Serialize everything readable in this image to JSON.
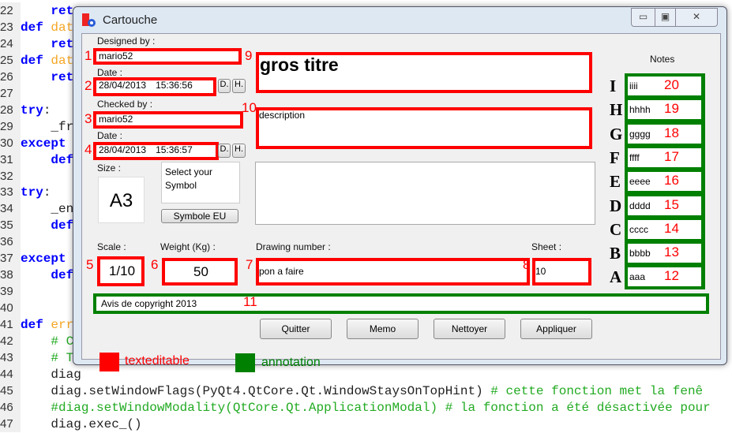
{
  "code_lines": [
    {
      "n": "22",
      "parts": [
        [
          "tx",
          "    "
        ],
        [
          "kw",
          "ret"
        ]
      ]
    },
    {
      "n": "23",
      "parts": [
        [
          "kw",
          "def "
        ],
        [
          "fn",
          "dat"
        ]
      ]
    },
    {
      "n": "24",
      "parts": [
        [
          "tx",
          "    "
        ],
        [
          "kw",
          "ret"
        ]
      ]
    },
    {
      "n": "25",
      "parts": [
        [
          "kw",
          "def "
        ],
        [
          "fn",
          "dat"
        ]
      ]
    },
    {
      "n": "26",
      "parts": [
        [
          "tx",
          "    "
        ],
        [
          "kw",
          "ret"
        ]
      ]
    },
    {
      "n": "27",
      "parts": []
    },
    {
      "n": "28",
      "parts": [
        [
          "kw",
          "try"
        ],
        [
          "tx",
          ":"
        ]
      ]
    },
    {
      "n": "29",
      "parts": [
        [
          "tx",
          "    _fr"
        ]
      ]
    },
    {
      "n": "30",
      "parts": [
        [
          "kw",
          "except"
        ]
      ]
    },
    {
      "n": "31",
      "parts": [
        [
          "tx",
          "    "
        ],
        [
          "kw",
          "def"
        ]
      ]
    },
    {
      "n": "32",
      "parts": []
    },
    {
      "n": "33",
      "parts": [
        [
          "kw",
          "try"
        ],
        [
          "tx",
          ":"
        ]
      ]
    },
    {
      "n": "34",
      "parts": [
        [
          "tx",
          "    _en"
        ]
      ]
    },
    {
      "n": "35",
      "parts": [
        [
          "tx",
          "    "
        ],
        [
          "kw",
          "def"
        ]
      ]
    },
    {
      "n": "36",
      "parts": []
    },
    {
      "n": "37",
      "parts": [
        [
          "kw",
          "except"
        ]
      ]
    },
    {
      "n": "38",
      "parts": [
        [
          "tx",
          "    "
        ],
        [
          "kw",
          "def"
        ]
      ]
    },
    {
      "n": "39",
      "parts": []
    },
    {
      "n": "40",
      "parts": []
    },
    {
      "n": "41",
      "parts": [
        [
          "kw",
          "def "
        ],
        [
          "fn",
          "err"
        ]
      ]
    },
    {
      "n": "42",
      "parts": [
        [
          "cm",
          "    # C"
        ]
      ]
    },
    {
      "n": "43",
      "parts": [
        [
          "cm",
          "    # T"
        ]
      ]
    },
    {
      "n": "44",
      "parts": [
        [
          "tx",
          "    diag"
        ]
      ]
    },
    {
      "n": "45",
      "parts": [
        [
          "tx",
          "    diag.setWindowFlags(PyQt4.QtCore.Qt.WindowStaysOnTopHint) "
        ],
        [
          "cm",
          "# cette fonction met la fenê"
        ]
      ]
    },
    {
      "n": "46",
      "parts": [
        [
          "cm",
          "    #diag.setWindowModality(QtCore.Qt.ApplicationModal) # la fonction a été désactivée pour"
        ]
      ]
    },
    {
      "n": "47",
      "parts": [
        [
          "tx",
          "    diag.exec_()"
        ]
      ]
    }
  ],
  "window": {
    "title": "Cartouche",
    "minimize": "▭",
    "maximize": "▣",
    "close": "✕"
  },
  "form": {
    "designed_by_label": "Designed by :",
    "designed_by": "mario52",
    "date_label": "Date :",
    "date1": "28/04/2013",
    "time1": "15:36:56",
    "checked_by_label": "Checked by :",
    "checked_by": "mario52",
    "date2": "28/04/2013",
    "time2": "15:36:57",
    "d_button": "D.",
    "h_button": "H.",
    "size_label": "Size :",
    "size": "A3",
    "symbol_text": "Select your Symbol",
    "symbol_button": "Symbole EU",
    "title": "gros titre",
    "description": "description",
    "scale_label": "Scale :",
    "scale": "1/10",
    "weight_label": "Weight (Kg) :",
    "weight": "50",
    "drawing_label": "Drawing number :",
    "drawing": "pon a faire",
    "sheet_label": "Sheet :",
    "sheet": "10",
    "copyright": "Avis de copyright 2013",
    "notes_label": "Notes",
    "notes": [
      {
        "letter": "I",
        "value": "iiii",
        "num": "20"
      },
      {
        "letter": "H",
        "value": "hhhh",
        "num": "19"
      },
      {
        "letter": "G",
        "value": "gggg",
        "num": "18"
      },
      {
        "letter": "F",
        "value": "ffff",
        "num": "17"
      },
      {
        "letter": "E",
        "value": "eeee",
        "num": "16"
      },
      {
        "letter": "D",
        "value": "dddd",
        "num": "15"
      },
      {
        "letter": "C",
        "value": "cccc",
        "num": "14"
      },
      {
        "letter": "B",
        "value": "bbbb",
        "num": "13"
      },
      {
        "letter": "A",
        "value": "aaa",
        "num": "12"
      }
    ],
    "markers": [
      "1",
      "2",
      "3",
      "4",
      "5",
      "6",
      "7",
      "8",
      "9",
      "10",
      "11"
    ]
  },
  "buttons": {
    "quit": "Quitter",
    "memo": "Memo",
    "clean": "Nettoyer",
    "apply": "Appliquer"
  },
  "legend": {
    "editable": "texteditable",
    "annotation": "annotation",
    "editable_color": "#ff0000",
    "annotation_color": "#008000"
  }
}
